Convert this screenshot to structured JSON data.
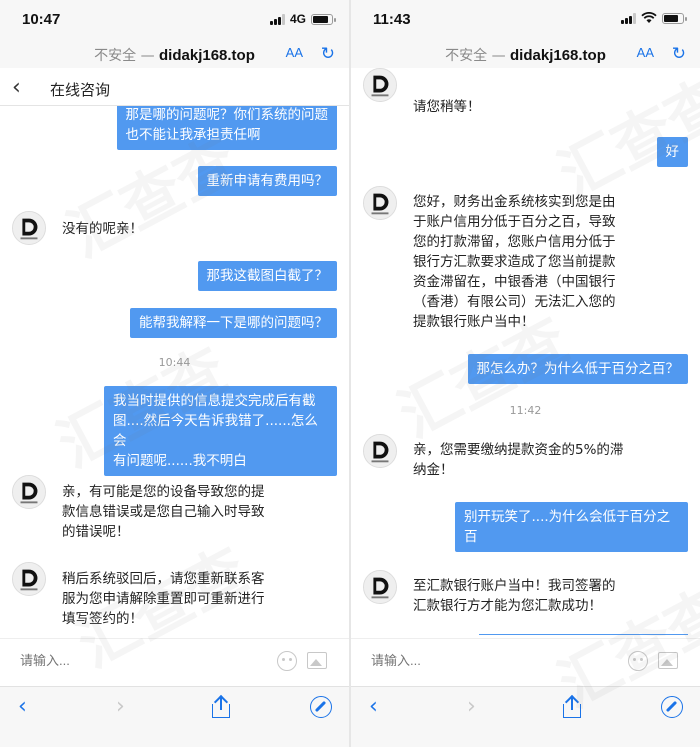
{
  "left": {
    "status": {
      "time": "10:47",
      "network": "4G"
    },
    "url": {
      "insecure": "不安全",
      "separator": "—",
      "domain": "didakj168.top",
      "aa": "AA"
    },
    "nav": {
      "title": "在线咨询"
    },
    "messages": {
      "m1_line1": "那是哪的问题呢？你们系统的问题",
      "m1_line2": "也不能让我承担责任啊",
      "m2": "重新申请有费用吗？",
      "m3": "没有的呢亲！",
      "m4": "那我这截图白截了？",
      "m5": "能帮我解释一下是哪的问题吗？",
      "time1": "10:44",
      "m6_l1": "我当时提供的信息提交完成后有截",
      "m6_l2": "图....然后今天告诉我错了......怎么会",
      "m6_l3": "有问题呢......我不明白",
      "m7_l1": "亲，有可能是您的设备导致您的提",
      "m7_l2": "款信息错误或是您自己输入时导致",
      "m7_l3": "的错误呢！",
      "m8_l1": "稍后系统驳回后，请您重新联系客",
      "m8_l2": "服为您申请解除重置即可重新进行",
      "m8_l3": "填写签约的！"
    },
    "input_placeholder": "请输入..."
  },
  "right": {
    "status": {
      "time": "11:43"
    },
    "url": {
      "insecure": "不安全",
      "separator": "—",
      "domain": "didakj168.top",
      "aa": "AA"
    },
    "messages": {
      "m0": "请您稍等！",
      "m1": "好",
      "m2_l1": "您好，财务出金系统核实到您是由",
      "m2_l2": "于账户信用分低于百分之百，导致",
      "m2_l3": "您的打款滞留，您账户信用分低于",
      "m2_l4": "银行方汇款要求造成了您当前提款",
      "m2_l5": "资金滞留在，中银香港（中国银行",
      "m2_l6": "（香港）有限公司）无法汇入您的",
      "m2_l7": "提款银行账户当中！",
      "m3": "那怎么办？为什么低于百分之百？",
      "time1": "11:42",
      "m4_l1": "亲，您需要缴纳提款资金的5%的滞",
      "m4_l2": "纳金！",
      "m5_l1": "别开玩笑了....为什么会低于百分之",
      "m5_l2": "百",
      "m6_l1": "至汇款银行账户当中！我司签署的",
      "m6_l2": "汇款银行方才能为您汇款成功！"
    },
    "input_placeholder": "请输入..."
  },
  "avatar_label": "帝达科技",
  "watermark": "汇查查",
  "colors": {
    "bubble": "#5199f0",
    "link_blue": "#1a73e8"
  }
}
